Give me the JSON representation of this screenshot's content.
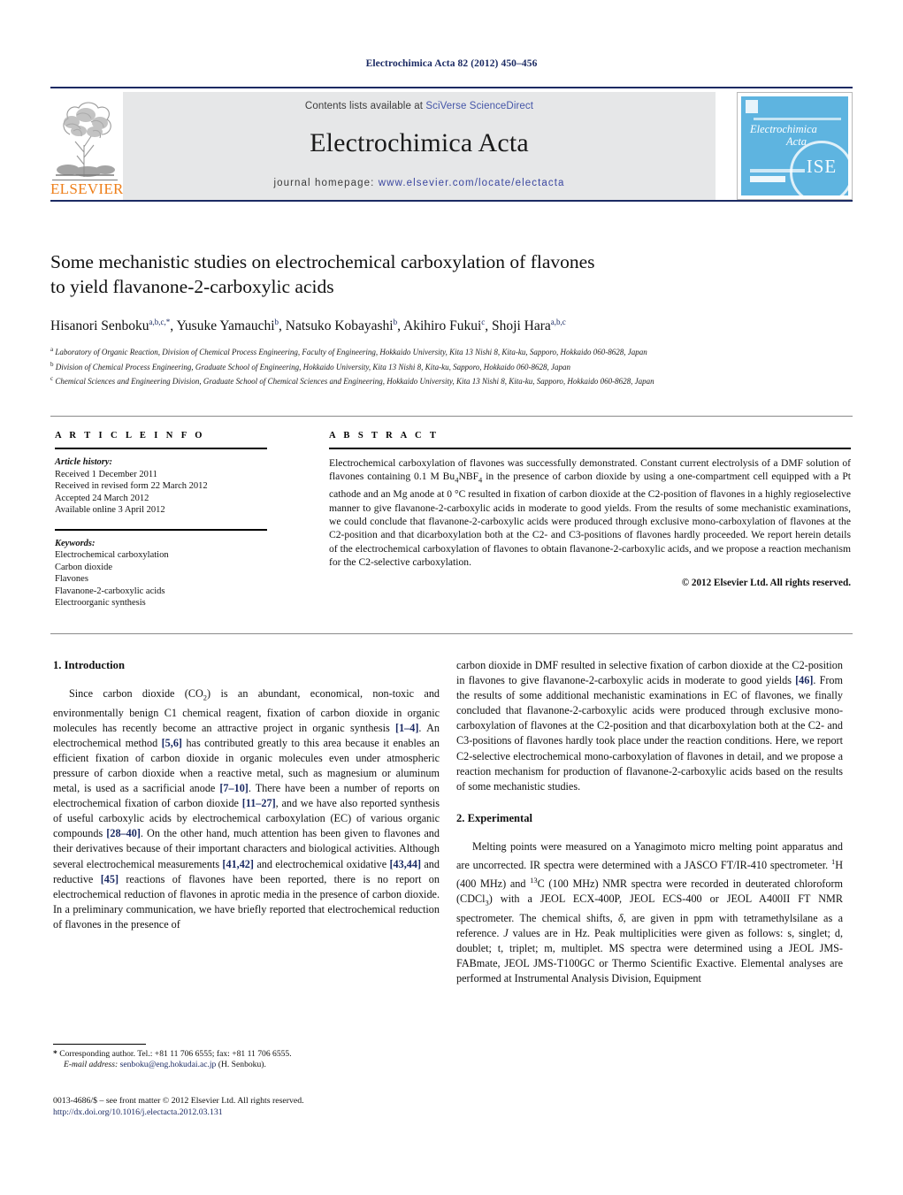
{
  "running_head": "Electrochimica Acta 82 (2012) 450–456",
  "masthead": {
    "contents_prefix": "Contents lists available at ",
    "contents_link": "SciVerse ScienceDirect",
    "journal_title": "Electrochimica Acta",
    "homepage_prefix": "journal homepage: ",
    "homepage_url": "www.elsevier.com/locate/electacta",
    "publisher_word": "ELSEVIER",
    "cover_line1": "Electrochimica",
    "cover_line2": "Acta",
    "accent_orange": "#ee7f1a",
    "accent_navy": "#1b2a63",
    "band_gray": "#e6e7e8",
    "cover_blue": "#5eb4e0"
  },
  "article": {
    "title_line1": "Some mechanistic studies on electrochemical carboxylation of flavones",
    "title_line2": "to yield flavanone-2-carboxylic acids",
    "authors_html": "Hisanori Senboku<sup>a,b,c,</sup><sup>*</sup>, Yusuke Yamauchi<sup>b</sup>, Natsuko Kobayashi<sup>b</sup>, Akihiro Fukui<sup>c</sup>, Shoji Hara<sup>a,b,c</sup>",
    "affiliations": [
      "Laboratory of Organic Reaction, Division of Chemical Process Engineering, Faculty of Engineering, Hokkaido University, Kita 13 Nishi 8, Kita-ku, Sapporo, Hokkaido 060-8628, Japan",
      "Division of Chemical Process Engineering, Graduate School of Engineering, Hokkaido University, Kita 13 Nishi 8, Kita-ku, Sapporo, Hokkaido 060-8628, Japan",
      "Chemical Sciences and Engineering Division, Graduate School of Chemical Sciences and Engineering, Hokkaido University, Kita 13 Nishi 8, Kita-ku, Sapporo, Hokkaido 060-8628, Japan"
    ],
    "affil_markers": [
      "a",
      "b",
      "c"
    ]
  },
  "article_info": {
    "heading": "A R T I C L E    I N F O",
    "history_label": "Article history:",
    "history": [
      "Received 1 December 2011",
      "Received in revised form 22 March 2012",
      "Accepted 24 March 2012",
      "Available online 3 April 2012"
    ],
    "keywords_label": "Keywords:",
    "keywords": [
      "Electrochemical carboxylation",
      "Carbon dioxide",
      "Flavones",
      "Flavanone-2-carboxylic acids",
      "Electroorganic synthesis"
    ]
  },
  "abstract": {
    "heading": "A B S T R A C T",
    "text_html": "Electrochemical carboxylation of flavones was successfully demonstrated. Constant current electrolysis of a DMF solution of flavones containing 0.1 M Bu<sub>4</sub>NBF<sub>4</sub> in the presence of carbon dioxide by using a one-compartment cell equipped with a Pt cathode and an Mg anode at 0 °C resulted in fixation of carbon dioxide at the C2-position of flavones in a highly regioselective manner to give flavanone-2-carboxylic acids in moderate to good yields. From the results of some mechanistic examinations, we could conclude that flavanone-2-carboxylic acids were produced through exclusive mono-carboxylation of flavones at the C2-position and that dicarboxylation both at the C2- and C3-positions of flavones hardly proceeded. We report herein details of the electrochemical carboxylation of flavones to obtain flavanone-2-carboxylic acids, and we propose a reaction mechanism for the C2-selective carboxylation.",
    "copyright": "© 2012 Elsevier Ltd. All rights reserved."
  },
  "body": {
    "section1_heading": "1.  Introduction",
    "section1_para_html": "Since carbon dioxide (CO<sub>2</sub>) is an abundant, economical, non-toxic and environmentally benign C1 chemical reagent, fixation of carbon dioxide in organic molecules has recently become an attractive project in organic synthesis <span class=\"ref\">[1–4]</span>. An electrochemical method <span class=\"ref\">[5,6]</span> has contributed greatly to this area because it enables an efficient fixation of carbon dioxide in organic molecules even under atmospheric pressure of carbon dioxide when a reactive metal, such as magnesium or aluminum metal, is used as a sacrificial anode <span class=\"ref\">[7–10]</span>. There have been a number of reports on electrochemical fixation of carbon dioxide <span class=\"ref\">[11–27]</span>, and we have also reported synthesis of useful carboxylic acids by electrochemical carboxylation (EC) of various organic compounds <span class=\"ref\">[28–40]</span>. On the other hand, much attention has been given to flavones and their derivatives because of their important characters and biological activities. Although several electrochemical measurements <span class=\"ref\">[41,42]</span> and electrochemical oxidative <span class=\"ref\">[43,44]</span> and reductive <span class=\"ref\">[45]</span> reactions of flavones have been reported, there is no report on electrochemical reduction of flavones in aprotic media in the presence of carbon dioxide. In a preliminary communication, we have briefly reported that electrochemical reduction of flavones in the presence of",
    "section1_para_cont_html": "carbon dioxide in DMF resulted in selective fixation of carbon dioxide at the C2-position in flavones to give flavanone-2-carboxylic acids in moderate to good yields <span class=\"ref\">[46]</span>. From the results of some additional mechanistic examinations in EC of flavones, we finally concluded that flavanone-2-carboxylic acids were produced through exclusive mono-carboxylation of flavones at the C2-position and that dicarboxylation both at the C2- and C3-positions of flavones hardly took place under the reaction conditions. Here, we report C2-selective electrochemical mono-carboxylation of flavones in detail, and we propose a reaction mechanism for production of flavanone-2-carboxylic acids based on the results of some mechanistic studies.",
    "section2_heading": "2.  Experimental",
    "section2_para_html": "Melting points were measured on a Yanagimoto micro melting point apparatus and are uncorrected. IR spectra were determined with a JASCO FT/IR-410 spectrometer. <sup>1</sup>H (400 MHz) and <sup>13</sup>C (100 MHz) NMR spectra were recorded in deuterated chloroform (CDCl<sub>3</sub>) with a JEOL ECX-400P, JEOL ECS-400 or JEOL A400II FT NMR spectrometer. The chemical shifts, <i>δ</i>, are given in ppm with tetramethylsilane as a reference. <i>J</i> values are in Hz. Peak multiplicities were given as follows: s, singlet; d, doublet; t, triplet; m, multiplet. MS spectra were determined using a JEOL JMS-FABmate, JEOL JMS-T100GC or Thermo Scientific Exactive. Elemental analyses are performed at Instrumental Analysis Division, Equipment"
  },
  "footer": {
    "corresponding_html": "<span style=\"font-weight:bold\">*</span>  Corresponding author. Tel.: +81 11 706 6555; fax: +81 11 706 6555.",
    "email_label": "E-mail address:",
    "email": "senboku@eng.hokudai.ac.jp",
    "email_suffix": "(H. Senboku).",
    "issn_line": "0013-4686/$ – see front matter © 2012 Elsevier Ltd. All rights reserved.",
    "doi": "http://dx.doi.org/10.1016/j.electacta.2012.03.131"
  }
}
